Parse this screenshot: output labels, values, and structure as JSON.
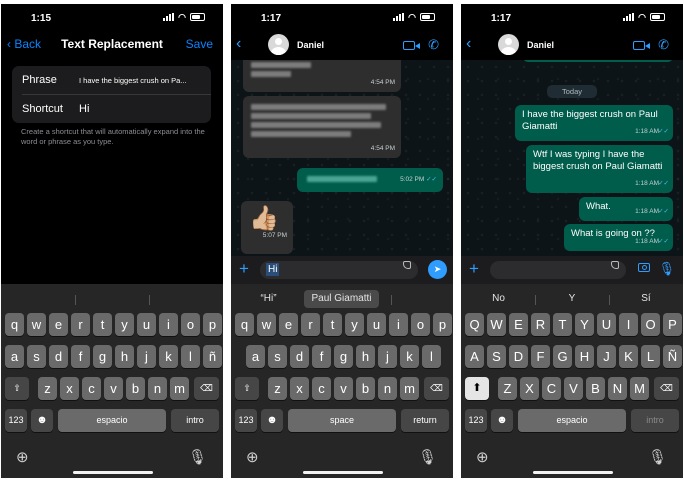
{
  "panel1": {
    "status": {
      "time": "1:15"
    },
    "nav": {
      "back": "Back",
      "title": "Text Replacement",
      "save": "Save"
    },
    "form": {
      "phrase_label": "Phrase",
      "phrase_value": "I have the biggest crush on Pa...",
      "shortcut_label": "Shortcut",
      "shortcut_value": "Hi"
    },
    "hint": "Create a shortcut that will automatically expand into the word or phrase as you type.",
    "keyboard": {
      "row1": [
        "q",
        "w",
        "e",
        "r",
        "t",
        "y",
        "u",
        "i",
        "o",
        "p"
      ],
      "row2": [
        "a",
        "s",
        "d",
        "f",
        "g",
        "h",
        "j",
        "k",
        "l",
        "ñ"
      ],
      "row3": [
        "z",
        "x",
        "c",
        "v",
        "b",
        "n",
        "m"
      ],
      "numbers": "123",
      "space": "espacio",
      "return": "intro"
    }
  },
  "panel2": {
    "status": {
      "time": "1:17"
    },
    "contact": "Daniel",
    "messages": [
      {
        "time": "4:54 PM"
      },
      {
        "time": "4:54 PM"
      },
      {
        "time": "5:02 PM"
      },
      {
        "emoji": "👍🏼",
        "time": "5:07 PM"
      }
    ],
    "input": "Hi",
    "suggestions": [
      "“Hi”",
      "Paul Giamatti"
    ],
    "keyboard": {
      "row1": [
        "q",
        "w",
        "e",
        "r",
        "t",
        "y",
        "u",
        "i",
        "o",
        "p"
      ],
      "row2": [
        "a",
        "s",
        "d",
        "f",
        "g",
        "h",
        "j",
        "k",
        "l"
      ],
      "row3": [
        "z",
        "x",
        "c",
        "v",
        "b",
        "n",
        "m"
      ],
      "numbers": "123",
      "space": "space",
      "return": "return"
    }
  },
  "panel3": {
    "status": {
      "time": "1:17"
    },
    "contact": "Daniel",
    "date_separator": "Today",
    "messages": [
      {
        "text": "I have the biggest crush on Paul Giamatti",
        "time": "1:18 AM"
      },
      {
        "text": "Wtf I was typing I have the biggest crush on Paul Giamatti",
        "time": "1:18 AM"
      },
      {
        "text": "What.",
        "time": "1:18 AM"
      },
      {
        "text": "What is going on ??",
        "time": "1:18 AM"
      }
    ],
    "suggestions": [
      "No",
      "Y",
      "Sí"
    ],
    "keyboard": {
      "row1": [
        "Q",
        "W",
        "E",
        "R",
        "T",
        "Y",
        "U",
        "I",
        "O",
        "P"
      ],
      "row2": [
        "A",
        "S",
        "D",
        "F",
        "G",
        "H",
        "J",
        "K",
        "L",
        "Ñ"
      ],
      "row3": [
        "Z",
        "X",
        "C",
        "V",
        "B",
        "N",
        "M"
      ],
      "numbers": "123",
      "space": "espacio",
      "return": "intro"
    }
  },
  "colors": {
    "accent": "#0a84ff",
    "whatsapp_outgoing": "#005c4b",
    "read_ticks": "#53bdeb"
  },
  "icons": [
    "back-chevron-icon",
    "video-call-icon",
    "phone-icon",
    "plus-icon",
    "sticker-icon",
    "send-icon",
    "camera-icon",
    "microphone-icon",
    "globe-icon",
    "emoji-icon",
    "shift-icon",
    "backspace-icon"
  ]
}
